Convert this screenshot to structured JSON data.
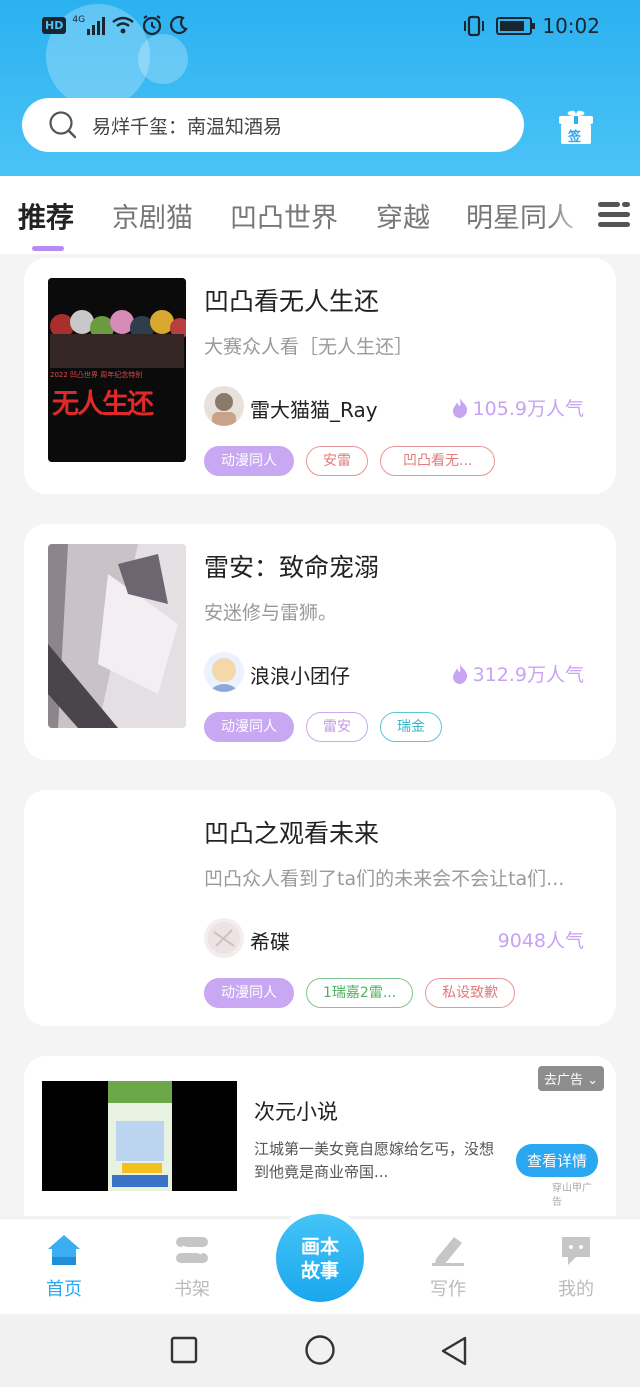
{
  "status_bar": {
    "left_icons": [
      "hd-badge",
      "4g-signal-icon",
      "wifi-icon",
      "alarm-icon",
      "moon-icon"
    ],
    "hd": "HD",
    "net": "4G",
    "time": "10:02"
  },
  "search": {
    "placeholder": "易烊千玺：南温知酒易"
  },
  "gift": {
    "label": "签"
  },
  "tabs": [
    {
      "label": "推荐",
      "active": true
    },
    {
      "label": "京剧猫"
    },
    {
      "label": "凹凸世界"
    },
    {
      "label": "穿越"
    },
    {
      "label": "明星同人"
    }
  ],
  "cards": [
    {
      "title": "凹凸看无人生还",
      "desc": "大赛众人看［无人生还］",
      "author": "雷大猫猫_Ray",
      "popularity": "105.9万人气",
      "cover_text": "无人生还",
      "cover_subtext": "2022 凹凸世界 周年纪念特别",
      "tags": [
        {
          "label": "动漫同人",
          "style": "primary"
        },
        {
          "label": "安雷",
          "style": "red"
        },
        {
          "label": "凹凸看无...",
          "style": "red"
        }
      ]
    },
    {
      "title": "雷安：致命宠溺",
      "desc": "安迷修与雷狮。",
      "author": "浪浪小团仔",
      "popularity": "312.9万人气",
      "tags": [
        {
          "label": "动漫同人",
          "style": "primary"
        },
        {
          "label": "雷安",
          "style": "purple"
        },
        {
          "label": "瑞金",
          "style": "cyan"
        }
      ]
    },
    {
      "title": "凹凸之观看未来",
      "desc": "凹凸众人看到了ta们的未来会不会让ta们...",
      "author": "希碟",
      "popularity": "9048人气",
      "tags": [
        {
          "label": "动漫同人",
          "style": "primary"
        },
        {
          "label": "1瑞嘉2雷...",
          "style": "green"
        },
        {
          "label": "私设致歉",
          "style": "red"
        }
      ]
    }
  ],
  "ad": {
    "close_label": "去广告",
    "title": "次元小说",
    "desc": "江城第一美女竟自愿嫁给乞丐，没想到他竟是商业帝国...",
    "button": "查看详情",
    "source": "穿山甲广告"
  },
  "bottom_nav": {
    "items": [
      {
        "label": "首页",
        "icon": "home-icon",
        "active": true
      },
      {
        "label": "书架",
        "icon": "bookshelf-icon"
      },
      {
        "label": "写作",
        "icon": "pen-icon"
      },
      {
        "label": "我的",
        "icon": "chat-icon"
      }
    ],
    "center": {
      "line1": "画本",
      "line2": "故事"
    }
  },
  "colors": {
    "brand": "#2aa7f0",
    "accent": "#b58cf0",
    "popularity": "#c7a3f2"
  }
}
